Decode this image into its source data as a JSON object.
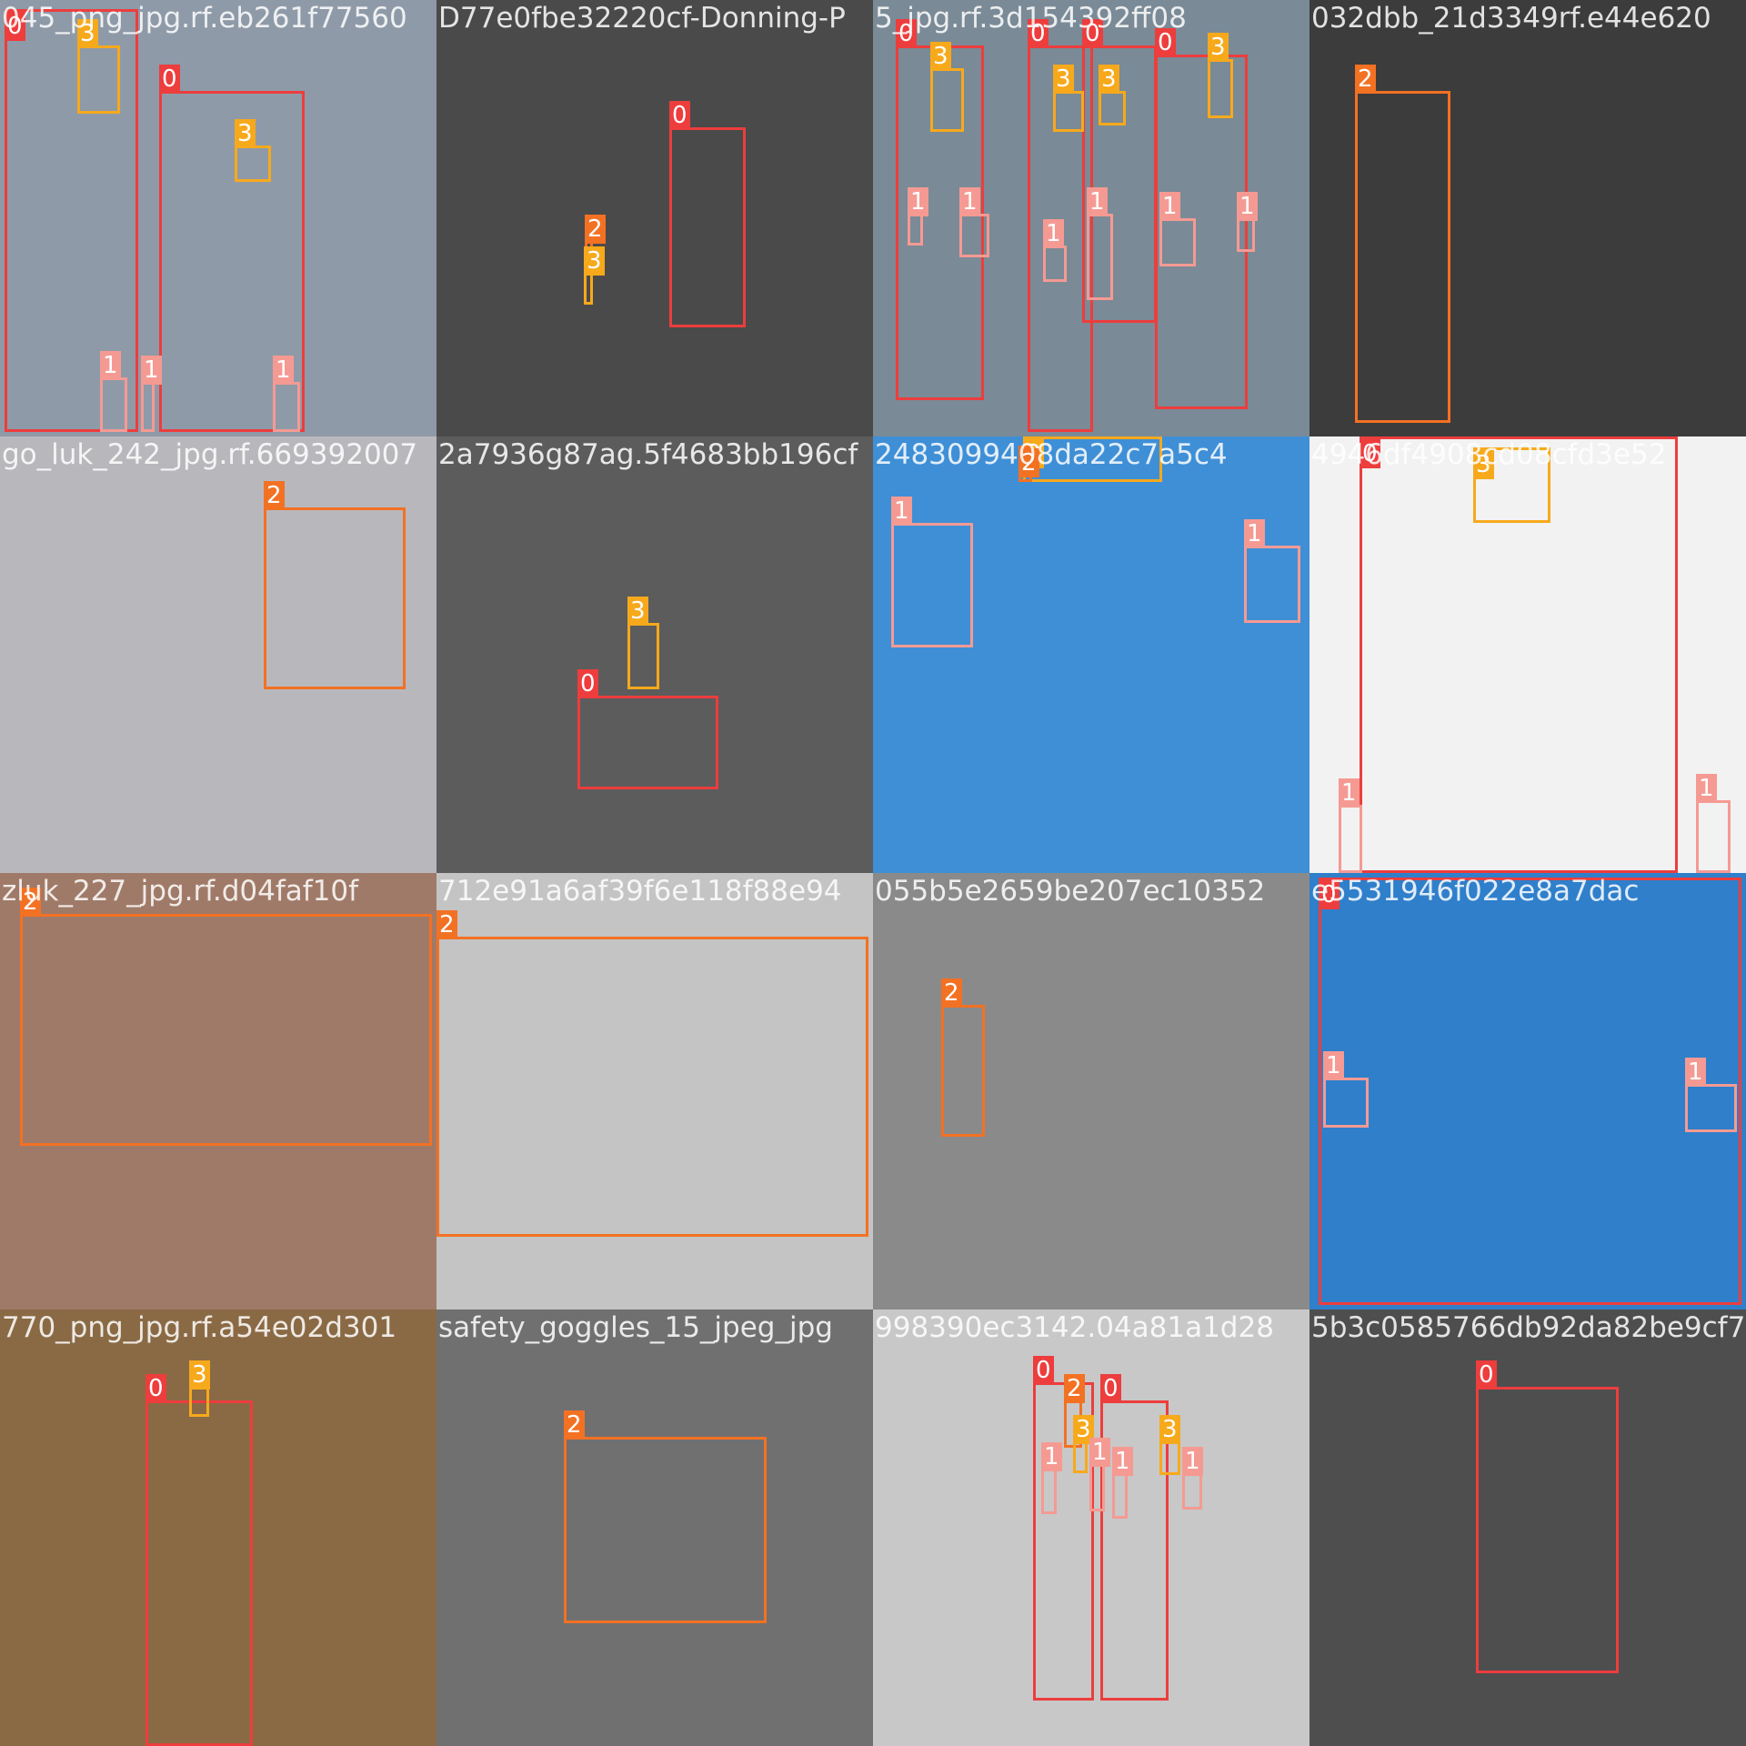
{
  "colors": {
    "class_0": "#ed3d3d",
    "class_1": "#f59a93",
    "class_2": "#f37123",
    "class_3": "#f7a91c"
  },
  "grid": {
    "rows": 4,
    "cols": 4
  },
  "tiles": [
    {
      "title": "045_png_jpg.rf.eb261f77560",
      "scene": "#8f9aa8",
      "boxes": [
        {
          "cls": "0"
        },
        {
          "cls": "0"
        },
        {
          "cls": "3"
        },
        {
          "cls": "3"
        },
        {
          "cls": "1"
        },
        {
          "cls": "1"
        },
        {
          "cls": "1"
        }
      ]
    },
    {
      "title": "D77e0fbe32220cf-Donning-P",
      "scene": "#4a4a4a",
      "boxes": [
        {
          "cls": "0"
        },
        {
          "cls": "2"
        },
        {
          "cls": "3"
        }
      ]
    },
    {
      "title": "5_jpg.rf.3d154392ff08",
      "scene": "#7a8a96",
      "boxes": [
        {
          "cls": "0"
        },
        {
          "cls": "0"
        },
        {
          "cls": "0"
        },
        {
          "cls": "0"
        },
        {
          "cls": "3"
        },
        {
          "cls": "3"
        },
        {
          "cls": "3"
        },
        {
          "cls": "3"
        },
        {
          "cls": "1"
        },
        {
          "cls": "1"
        },
        {
          "cls": "1"
        },
        {
          "cls": "1"
        },
        {
          "cls": "1"
        },
        {
          "cls": "1"
        }
      ]
    },
    {
      "title": "032dbb_21d3349rf.e44e620",
      "scene": "#3c3c3c",
      "boxes": [
        {
          "cls": "2"
        }
      ]
    },
    {
      "title": "go_luk_242_jpg.rf.669392007",
      "scene": "#b8b8bc",
      "boxes": [
        {
          "cls": "2"
        }
      ]
    },
    {
      "title": "2a7936g87ag.5f4683bb196cf",
      "scene": "#5c5c5c",
      "boxes": [
        {
          "cls": "0"
        },
        {
          "cls": "3"
        }
      ]
    },
    {
      "title": "2483099408da22c7a5c4",
      "scene": "#3f8fd6",
      "boxes": [
        {
          "cls": "3"
        },
        {
          "cls": "2"
        },
        {
          "cls": "1"
        },
        {
          "cls": "1"
        }
      ]
    },
    {
      "title": "4946df4908cd08cfd3e52",
      "scene": "#f2f2f2",
      "boxes": [
        {
          "cls": "0"
        },
        {
          "cls": "3"
        },
        {
          "cls": "1"
        },
        {
          "cls": "1"
        }
      ]
    },
    {
      "title": "zluk_227_jpg.rf.d04faf10f",
      "scene": "#a07a68",
      "boxes": [
        {
          "cls": "2"
        }
      ]
    },
    {
      "title": "712e91a6af39f6e118f88e94",
      "scene": "#c4c4c4",
      "boxes": [
        {
          "cls": "2"
        }
      ]
    },
    {
      "title": "055b5e2659be207ec10352",
      "scene": "#8a8a8a",
      "boxes": [
        {
          "cls": "2"
        }
      ]
    },
    {
      "title": "e5531946f022e8a7dac",
      "scene": "#2f7fcb",
      "boxes": [
        {
          "cls": "0"
        },
        {
          "cls": "1"
        },
        {
          "cls": "1"
        }
      ]
    },
    {
      "title": "770_png_jpg.rf.a54e02d301",
      "scene": "#8a6a45",
      "boxes": [
        {
          "cls": "0"
        },
        {
          "cls": "3"
        }
      ]
    },
    {
      "title": "safety_goggles_15_jpeg_jpg",
      "scene": "#707070",
      "boxes": [
        {
          "cls": "2"
        }
      ]
    },
    {
      "title": "998390ec3142.04a81a1d28",
      "scene": "#c8c8c8",
      "boxes": [
        {
          "cls": "0"
        },
        {
          "cls": "0"
        },
        {
          "cls": "2"
        },
        {
          "cls": "3"
        },
        {
          "cls": "3"
        },
        {
          "cls": "1"
        },
        {
          "cls": "1"
        },
        {
          "cls": "1"
        },
        {
          "cls": "1"
        }
      ]
    },
    {
      "title": "5b3c0585766db92da82be9cf7",
      "scene": "#4e4e4e",
      "boxes": [
        {
          "cls": "0"
        }
      ]
    }
  ]
}
